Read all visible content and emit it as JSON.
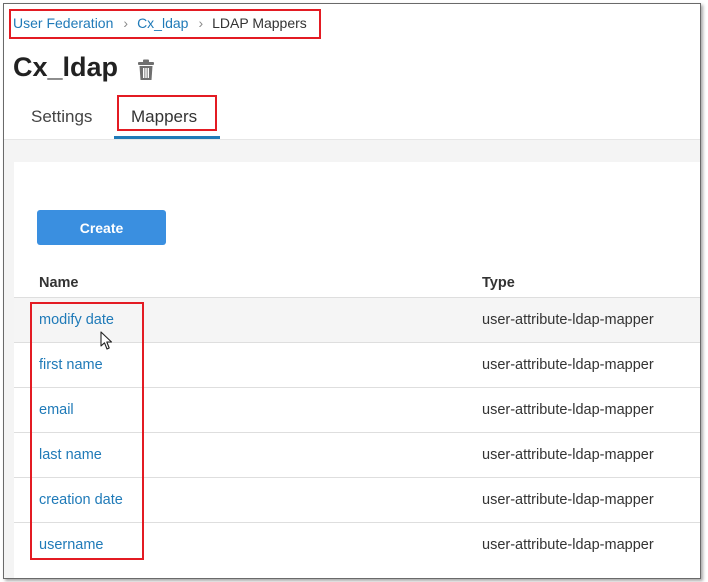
{
  "breadcrumb": {
    "items": [
      {
        "label": "User Federation"
      },
      {
        "label": "Cx_ldap"
      },
      {
        "label": "LDAP Mappers"
      }
    ],
    "separator": "›"
  },
  "page": {
    "title": "Cx_ldap",
    "delete_icon": "trash-icon"
  },
  "tabs": [
    {
      "label": "Settings",
      "active": false
    },
    {
      "label": "Mappers",
      "active": true
    }
  ],
  "toolbar": {
    "create_label": "Create"
  },
  "table": {
    "columns": [
      "Name",
      "Type"
    ],
    "rows": [
      {
        "name": "modify date",
        "type": "user-attribute-ldap-mapper"
      },
      {
        "name": "first name",
        "type": "user-attribute-ldap-mapper"
      },
      {
        "name": "email",
        "type": "user-attribute-ldap-mapper"
      },
      {
        "name": "last name",
        "type": "user-attribute-ldap-mapper"
      },
      {
        "name": "creation date",
        "type": "user-attribute-ldap-mapper"
      },
      {
        "name": "username",
        "type": "user-attribute-ldap-mapper"
      }
    ]
  },
  "colors": {
    "link": "#1f7ab8",
    "primary_button": "#3a8fe0",
    "highlight": "#e31b23"
  }
}
